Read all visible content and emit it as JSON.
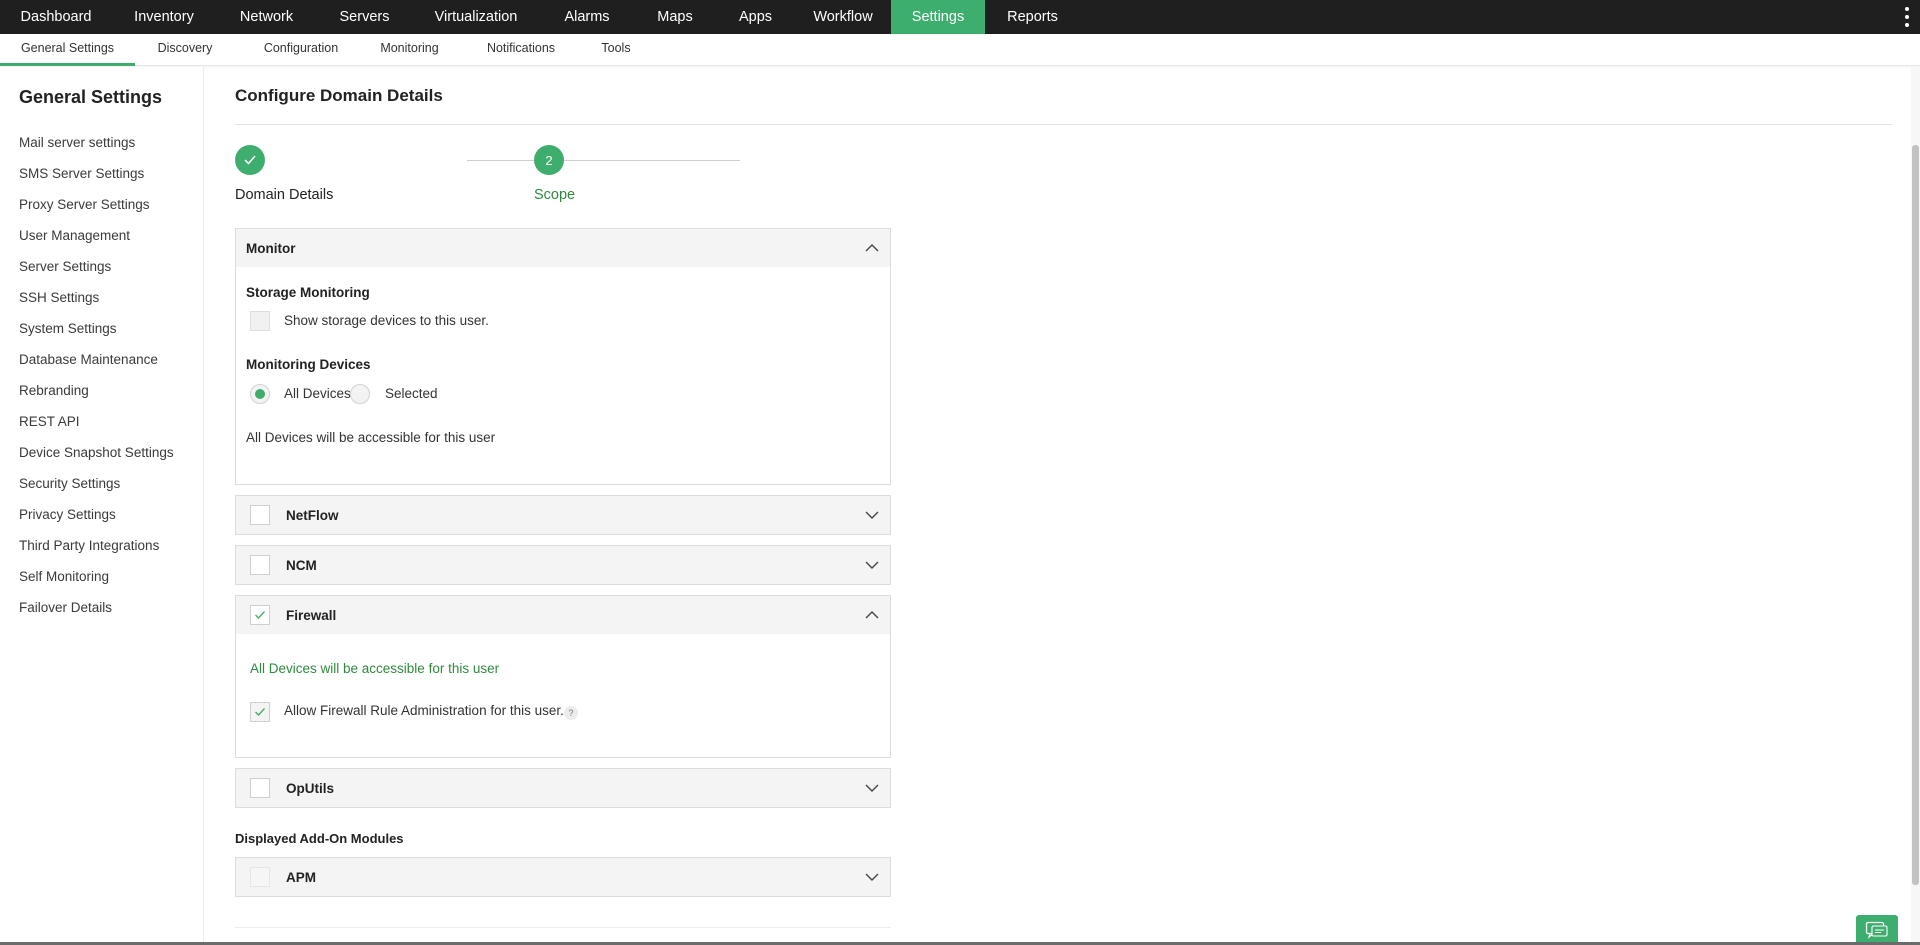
{
  "topnav": {
    "items": [
      "Dashboard",
      "Inventory",
      "Network",
      "Servers",
      "Virtualization",
      "Alarms",
      "Maps",
      "Apps",
      "Workflow",
      "Settings",
      "Reports"
    ],
    "active": "Settings",
    "more_icon": "kebab-menu-icon"
  },
  "subnav": {
    "items": [
      "General Settings",
      "Discovery",
      "Configuration",
      "Monitoring",
      "Notifications",
      "Tools"
    ],
    "active": "General Settings"
  },
  "sidebar": {
    "title": "General Settings",
    "items": [
      "Mail server settings",
      "SMS Server Settings",
      "Proxy Server Settings",
      "User Management",
      "Server Settings",
      "SSH Settings",
      "System Settings",
      "Database Maintenance",
      "Rebranding",
      "REST API",
      "Device Snapshot Settings",
      "Security Settings",
      "Privacy Settings",
      "Third Party Integrations",
      "Self Monitoring",
      "Failover Details"
    ]
  },
  "main": {
    "title": "Configure Domain Details",
    "steps": [
      {
        "number": "",
        "label": "Domain Details",
        "status": "completed"
      },
      {
        "number": "2",
        "label": "Scope",
        "status": "current"
      }
    ],
    "monitor": {
      "title": "Monitor",
      "expanded": true,
      "storage_heading": "Storage Monitoring",
      "storage_checkbox_label": "Show storage devices to this user.",
      "storage_checked": false,
      "devices_heading": "Monitoring Devices",
      "radio_all": "All Devices",
      "radio_selected": "Selected",
      "selected_option": "All Devices",
      "note": "All Devices will be accessible for this user"
    },
    "netflow": {
      "title": "NetFlow",
      "checked": false,
      "expanded": false
    },
    "ncm": {
      "title": "NCM",
      "checked": false,
      "expanded": false
    },
    "firewall": {
      "title": "Firewall",
      "checked": true,
      "expanded": true,
      "note": "All Devices will be accessible for this user",
      "rule_admin_label": "Allow Firewall Rule Administration for this user.",
      "rule_admin_checked": true,
      "help_glyph": "?"
    },
    "oputils": {
      "title": "OpUtils",
      "checked": false,
      "expanded": false
    },
    "addon_heading": "Displayed Add-On Modules",
    "apm": {
      "title": "APM",
      "checked": false,
      "expanded": false
    }
  },
  "colors": {
    "accent": "#3dae6e",
    "topnav_bg": "#1f1f1f",
    "note_green": "#2f8a3e"
  }
}
